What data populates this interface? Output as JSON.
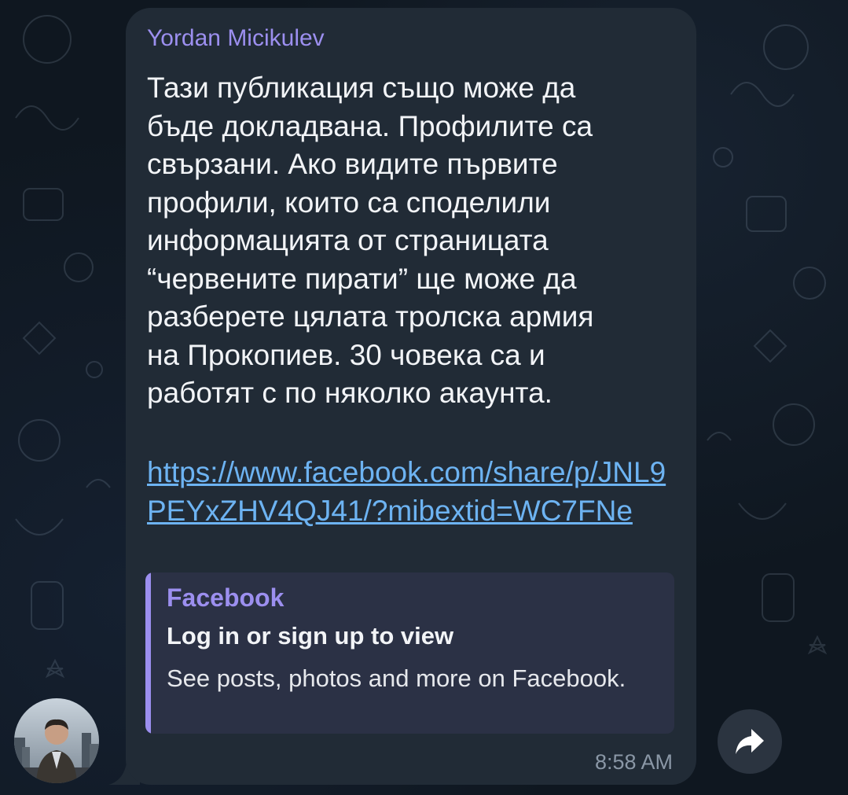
{
  "message": {
    "sender": "Yordan Micikulev",
    "text": "Тази публикация също може да\nбъде докладвана. Профилите са\nсвързани. Ако видите първите\nпрофили, които са споделили\nинформацията от страницата\n“червените пирати” ще може да\nразберете цялата тролска армия\nна Прокопиев. 30 човека са и\nработят с по няколко акаунта.",
    "link": "https://www.facebook.com/share/p/JNL9PEYxZHV4QJ41/?mibextid=WC7FNe",
    "time": "8:58 AM"
  },
  "link_preview": {
    "site": "Facebook",
    "title": "Log in or sign up to view",
    "description": "See posts, photos and more on Facebook."
  },
  "icons": {
    "share": "share-arrow-icon",
    "avatar": "avatar"
  },
  "colors": {
    "background": "#0f1720",
    "bubble": "#212b36",
    "sender_name": "#9c8fef",
    "link": "#6db3f2",
    "preview_bg": "#2b3145",
    "timestamp": "#8a97a6"
  }
}
